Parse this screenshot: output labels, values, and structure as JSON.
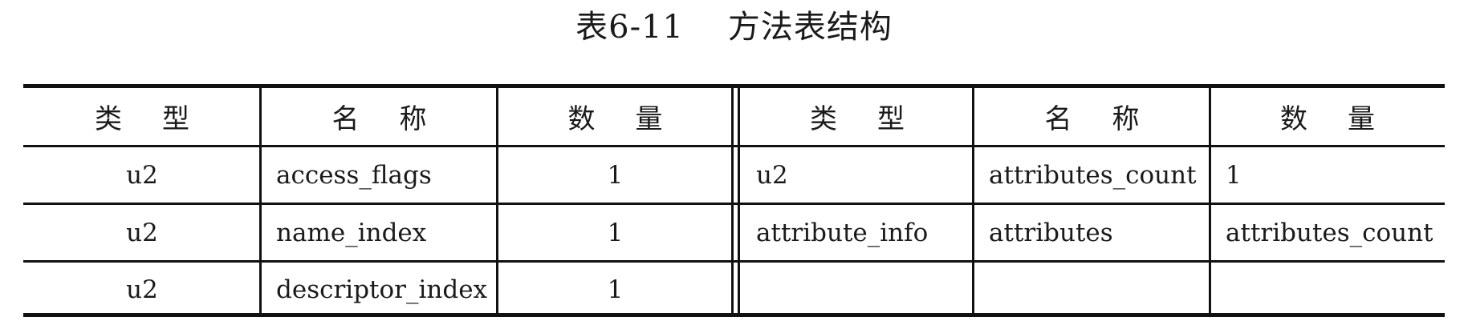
{
  "caption": "表6-11    方法表结构",
  "table": {
    "headers": [
      "类型",
      "名称",
      "数量",
      "类型",
      "名称",
      "数量"
    ],
    "rows": [
      [
        "u2",
        "access_flags",
        "1",
        "u2",
        "attributes_count",
        "1"
      ],
      [
        "u2",
        "name_index",
        "1",
        "attribute_info",
        "attributes",
        "attributes_count"
      ],
      [
        "u2",
        "descriptor_index",
        "1",
        "",
        "",
        ""
      ]
    ]
  }
}
